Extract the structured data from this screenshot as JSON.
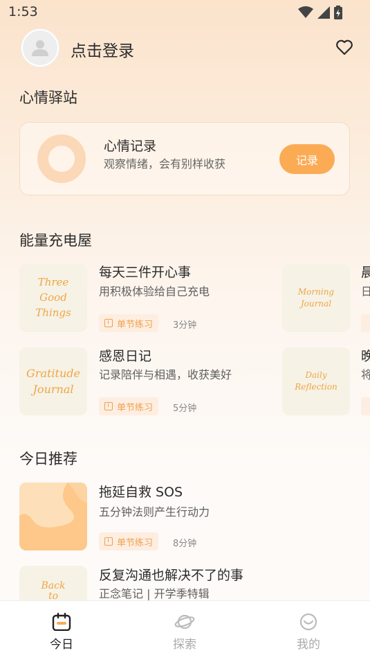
{
  "status_bar": {
    "time": "1:53"
  },
  "header": {
    "login_label": "点击登录"
  },
  "mood_section": {
    "title": "心情驿站",
    "card_title": "心情记录",
    "card_subtitle": "观察情绪，会有别样收获",
    "record_button": "记录"
  },
  "energy_section": {
    "title": "能量充电屋",
    "items": [
      {
        "thumb": [
          "Three",
          "Good",
          "Things"
        ],
        "title": "每天三件开心事",
        "subtitle": "用积极体验给自己充电",
        "tag": "单节练习",
        "duration": "3分钟"
      },
      {
        "thumb": [
          "Morning",
          "Journal"
        ],
        "title": "晨",
        "subtitle": "日",
        "tag": "",
        "duration": ""
      },
      {
        "thumb": [
          "Gratitude",
          "Journal"
        ],
        "title": "感恩日记",
        "subtitle": "记录陪伴与相遇，收获美好",
        "tag": "单节练习",
        "duration": "5分钟"
      },
      {
        "thumb": [
          "Daily",
          "Reflection"
        ],
        "title": "晚",
        "subtitle": "将",
        "tag": "",
        "duration": ""
      }
    ]
  },
  "today_section": {
    "title": "今日推荐",
    "items": [
      {
        "title": "拖延自救 SOS",
        "subtitle": "五分钟法则产生行动力",
        "tag": "单节练习",
        "duration": "8分钟"
      },
      {
        "thumb": [
          "Back",
          "to"
        ],
        "title": "反复沟通也解决不了的事",
        "subtitle": "正念笔记 | 开学季特辑"
      }
    ]
  },
  "bottom_nav": {
    "tabs": [
      {
        "label": "今日",
        "icon": "calendar-icon",
        "active": true
      },
      {
        "label": "探索",
        "icon": "planet-icon",
        "active": false
      },
      {
        "label": "我的",
        "icon": "smiley-icon",
        "active": false
      }
    ]
  },
  "colors": {
    "accent": "#fcab55",
    "tag_bg": "#fdeee1",
    "tag_text": "#f0a04b",
    "ring": "#fbd8b7"
  }
}
